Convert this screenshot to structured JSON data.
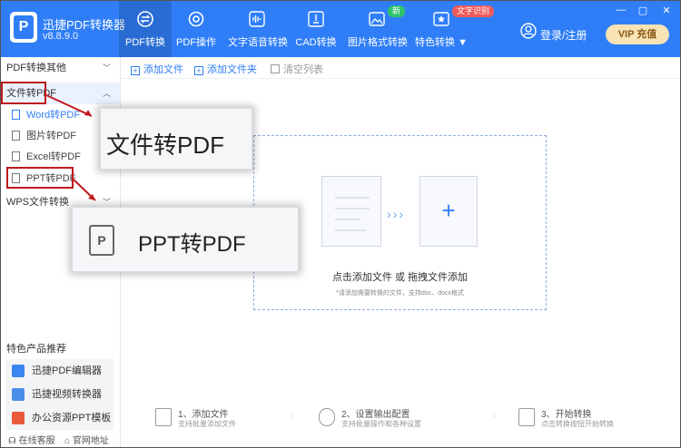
{
  "app": {
    "name": "迅捷PDF转换器",
    "version": "v8.8.9.0"
  },
  "nav": [
    {
      "label": "PDF转换",
      "icon": "refresh-doc-icon"
    },
    {
      "label": "PDF操作",
      "icon": "gear-icon"
    },
    {
      "label": "文字语音转换",
      "icon": "audio-wave-icon"
    },
    {
      "label": "CAD转换",
      "icon": "cad-icon"
    },
    {
      "label": "图片格式转换",
      "icon": "image-icon"
    },
    {
      "label": "特色转换",
      "icon": "star-icon"
    }
  ],
  "badges": {
    "new": "新",
    "text_recognition": "文字识别"
  },
  "login": "登录/注册",
  "vip": {
    "badge": "VIP",
    "label": "充值"
  },
  "sidebar": {
    "section_other": "PDF转换其他",
    "section_file": "文件转PDF",
    "items": [
      {
        "label": "Word转PDF"
      },
      {
        "label": "图片转PDF"
      },
      {
        "label": "Excel转PDF"
      },
      {
        "label": "PPT转PDF"
      }
    ],
    "section_wps": "WPS文件转换",
    "products_title": "特色产品推荐",
    "products": [
      {
        "label": "迅捷PDF编辑器"
      },
      {
        "label": "迅捷视频转换器"
      },
      {
        "label": "办公资源PPT模板"
      }
    ],
    "footer": {
      "service": "在线客服",
      "website": "官网地址"
    }
  },
  "toolbar": {
    "add_file": "添加文件",
    "add_folder": "添加文件夹",
    "clear_list": "清空列表"
  },
  "dropzone": {
    "main": "点击添加文件 或 拖拽文件添加",
    "hint": "*请添加需要转换的文件，支持doc、docx格式"
  },
  "callouts": {
    "file_to_pdf": "文件转PDF",
    "ppt_to_pdf": "PPT转PDF",
    "ppt_glyph": "P"
  },
  "steps": [
    {
      "title": "1、添加文件",
      "desc": "支持批量添加文件"
    },
    {
      "title": "2、设置输出配置",
      "desc": "支持批量操作和各种设置"
    },
    {
      "title": "3、开始转换",
      "desc": "点击转换按钮开始转换"
    }
  ],
  "colors": {
    "brand": "#2f7ef7",
    "highlight_border": "#c0191e",
    "vip_bg": "#f7e3b4"
  }
}
